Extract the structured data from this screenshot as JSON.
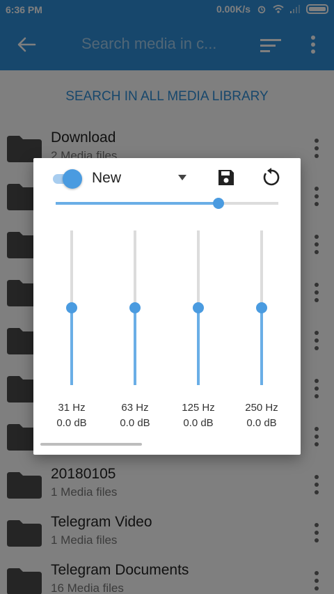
{
  "status_bar": {
    "time": "6:36 PM",
    "network_speed": "0.00K/s",
    "icons": [
      "alarm-icon",
      "wifi-icon",
      "signal-icon",
      "battery-icon"
    ]
  },
  "app_bar": {
    "search_placeholder": "Search media in c...",
    "icons": [
      "back-arrow-icon",
      "sort-icon",
      "more-vert-icon"
    ]
  },
  "search_all_label": "SEARCH IN ALL MEDIA LIBRARY",
  "folders": [
    {
      "name": "Download",
      "count": "2 Media files"
    },
    {
      "name": "",
      "count": ""
    },
    {
      "name": "",
      "count": ""
    },
    {
      "name": "",
      "count": ""
    },
    {
      "name": "",
      "count": ""
    },
    {
      "name": "",
      "count": ""
    },
    {
      "name": "",
      "count": ""
    },
    {
      "name": "20180105",
      "count": "1 Media files"
    },
    {
      "name": "Telegram Video",
      "count": "1 Media files"
    },
    {
      "name": "Telegram Documents",
      "count": "16 Media files"
    }
  ],
  "equalizer": {
    "enabled": true,
    "preset": "New",
    "preamp_level": 0.73,
    "bands": [
      {
        "freq": "31 Hz",
        "gain": "0.0 dB",
        "level": 0.5
      },
      {
        "freq": "63 Hz",
        "gain": "0.0 dB",
        "level": 0.5
      },
      {
        "freq": "125 Hz",
        "gain": "0.0 dB",
        "level": 0.5
      },
      {
        "freq": "250 Hz",
        "gain": "0.0 dB",
        "level": 0.5
      }
    ]
  },
  "colors": {
    "accent": "#2f8fd8",
    "slider": "#4a9be0",
    "slider_fill": "#6aaee6"
  }
}
